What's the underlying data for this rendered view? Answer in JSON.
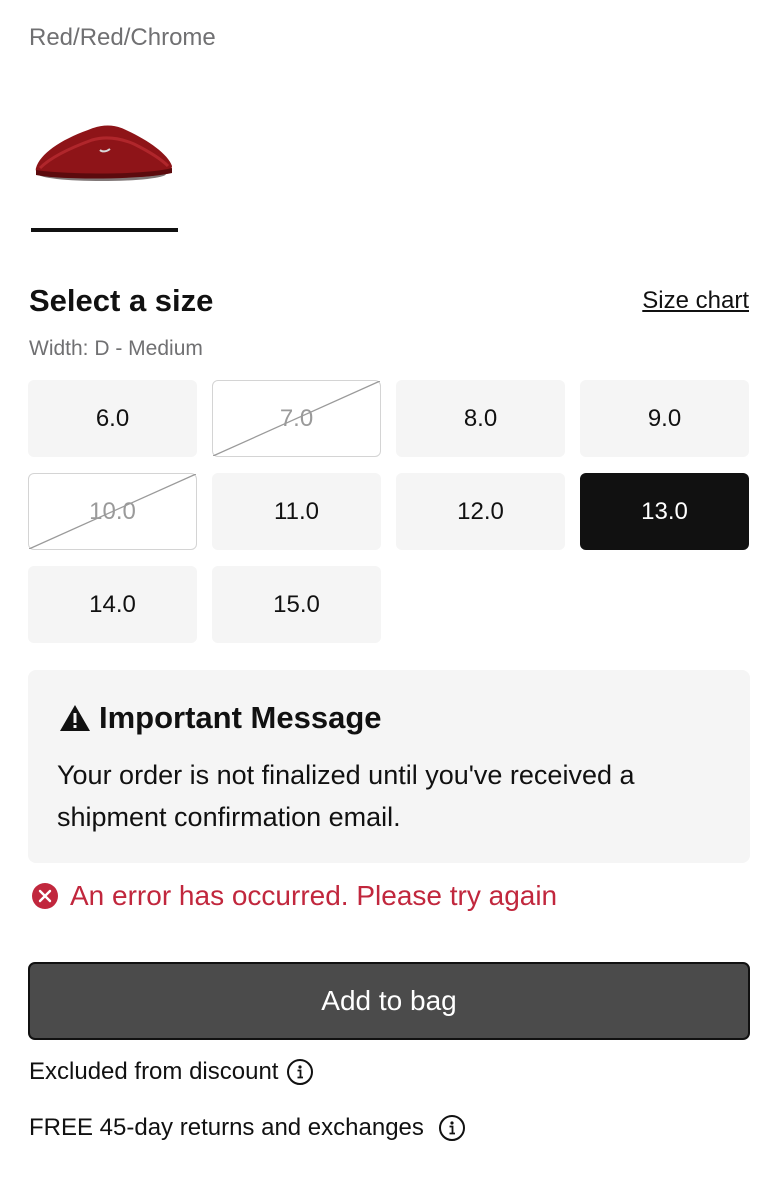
{
  "product": {
    "colorway": "Red/Red/Chrome",
    "thumbnail_icon": "red-slide-shoe-thumbnail"
  },
  "size_section": {
    "title": "Select a size",
    "size_chart_label": "Size chart",
    "width_label": "Width: D - Medium",
    "sizes": [
      {
        "label": "6.0",
        "available": true,
        "selected": false
      },
      {
        "label": "7.0",
        "available": false,
        "selected": false
      },
      {
        "label": "8.0",
        "available": true,
        "selected": false
      },
      {
        "label": "9.0",
        "available": true,
        "selected": false
      },
      {
        "label": "10.0",
        "available": false,
        "selected": false
      },
      {
        "label": "11.0",
        "available": true,
        "selected": false
      },
      {
        "label": "12.0",
        "available": true,
        "selected": false
      },
      {
        "label": "13.0",
        "available": true,
        "selected": true
      },
      {
        "label": "14.0",
        "available": true,
        "selected": false
      },
      {
        "label": "15.0",
        "available": true,
        "selected": false
      }
    ]
  },
  "important_message": {
    "icon": "warning-triangle-icon",
    "title": "Important Message",
    "body": "Your order is not finalized until you've received a shipment confirmation email."
  },
  "error": {
    "icon": "error-circle-icon",
    "text": "An error has occurred. Please try again",
    "color": "#c1273d"
  },
  "cta": {
    "add_to_bag_label": "Add to bag"
  },
  "info": {
    "discount_label": "Excluded from discount",
    "returns_label": "FREE 45-day returns and exchanges",
    "icon": "info-circle-icon"
  }
}
